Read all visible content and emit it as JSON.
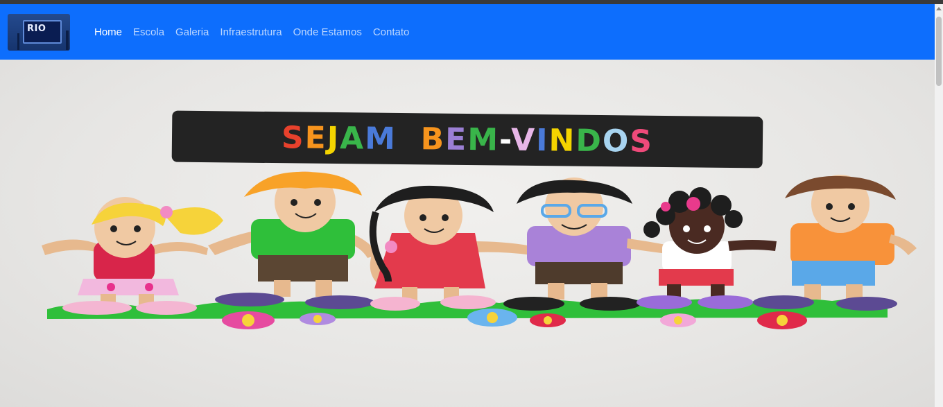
{
  "navbar": {
    "logo_text": "RIO",
    "links": [
      {
        "label": "Home",
        "active": true
      },
      {
        "label": "Escola",
        "active": false
      },
      {
        "label": "Galeria",
        "active": false
      },
      {
        "label": "Infraestrutura",
        "active": false
      },
      {
        "label": "Onde Estamos",
        "active": false
      },
      {
        "label": "Contato",
        "active": false
      }
    ],
    "color": "#0d6efd"
  },
  "hero": {
    "banner_words": [
      {
        "text": "S",
        "color": "#e8412c"
      },
      {
        "text": "E",
        "color": "#f7941d"
      },
      {
        "text": "J",
        "color": "#f4d400"
      },
      {
        "text": "A",
        "color": "#39b54a"
      },
      {
        "text": "M",
        "color": "#4a7ad9"
      },
      {
        "text": "  ",
        "color": "#ffffff"
      },
      {
        "text": "B",
        "color": "#f7941d"
      },
      {
        "text": "E",
        "color": "#9b7fd4"
      },
      {
        "text": "M",
        "color": "#39b54a"
      },
      {
        "text": "-",
        "color": "#ffffff"
      },
      {
        "text": "V",
        "color": "#e7b6e8"
      },
      {
        "text": "I",
        "color": "#4a7ad9"
      },
      {
        "text": "N",
        "color": "#f4d400"
      },
      {
        "text": "D",
        "color": "#39b54a"
      },
      {
        "text": "O",
        "color": "#a8d4f0"
      },
      {
        "text": "S",
        "color": "#ef4a7a"
      }
    ]
  }
}
